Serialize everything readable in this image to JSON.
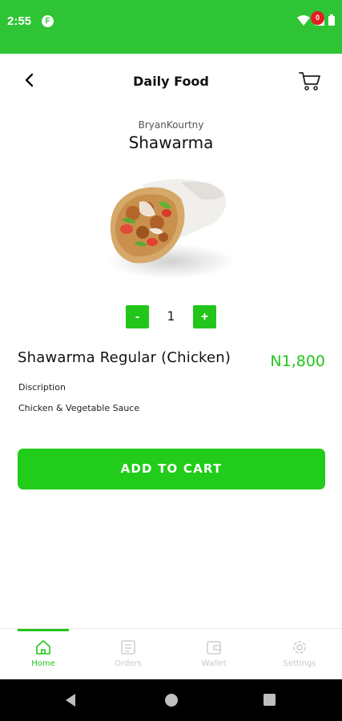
{
  "status_bar": {
    "time": "2:55",
    "app_icon_letter": "F"
  },
  "header": {
    "title": "Daily Food",
    "cart_count": "0"
  },
  "product": {
    "vendor": "BryanKourtny",
    "title": "Shawarma",
    "image_alt": "shawarma-wrap",
    "quantity": "1",
    "minus_label": "-",
    "plus_label": "+",
    "item_name": "Shawarma Regular (Chicken)",
    "price": "N1,800",
    "description_label": "Discription",
    "description": "Chicken & Vegetable Sauce"
  },
  "actions": {
    "add_to_cart": "ADD TO CART"
  },
  "bottom_nav": {
    "items": [
      {
        "label": "Home",
        "icon": "home-icon",
        "active": true
      },
      {
        "label": "Orders",
        "icon": "orders-icon",
        "active": false
      },
      {
        "label": "Wallet",
        "icon": "wallet-icon",
        "active": false
      },
      {
        "label": "Settings",
        "icon": "settings-icon",
        "active": false
      }
    ]
  },
  "colors": {
    "brand_green": "#22c51a",
    "status_bar": "#2ec435",
    "badge_red": "#e51c23"
  }
}
